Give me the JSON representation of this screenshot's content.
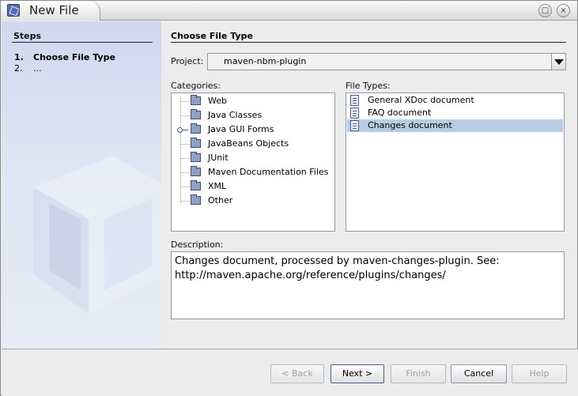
{
  "window": {
    "title": "New File",
    "maximize_symbol": "□",
    "close_symbol": "×"
  },
  "steps": {
    "title": "Steps",
    "items": [
      {
        "number": "1.",
        "label": "Choose File Type"
      },
      {
        "number": "2.",
        "label": "..."
      }
    ]
  },
  "main": {
    "title": "Choose File Type",
    "project_label": "Project:",
    "project_value": "maven-nbm-plugin",
    "categories_label": "Categories:",
    "categories": [
      {
        "label": "Web"
      },
      {
        "label": "Java Classes"
      },
      {
        "label": "Java GUI Forms",
        "has_handle": true
      },
      {
        "label": "JavaBeans Objects"
      },
      {
        "label": "JUnit"
      },
      {
        "label": "Maven Documentation Files"
      },
      {
        "label": "XML"
      },
      {
        "label": "Other"
      }
    ],
    "file_types_label": "File Types:",
    "file_types": [
      {
        "label": "General XDoc document",
        "selected": false
      },
      {
        "label": "FAQ document",
        "selected": false
      },
      {
        "label": "Changes document",
        "selected": true
      }
    ],
    "description_label": "Description:",
    "description_text": "Changes document, processed by maven-changes-plugin. See:\nhttp://maven.apache.org/reference/plugins/changes/"
  },
  "buttons": {
    "back": "< Back",
    "next": "Next >",
    "finish": "Finish",
    "cancel": "Cancel",
    "help": "Help"
  },
  "colors": {
    "selection": "#b8cde3",
    "steps_panel": "#dfe5f3"
  },
  "icons": {
    "category": "folder-icon",
    "file_type": "document-icon",
    "app": "netbeans-app-icon"
  }
}
